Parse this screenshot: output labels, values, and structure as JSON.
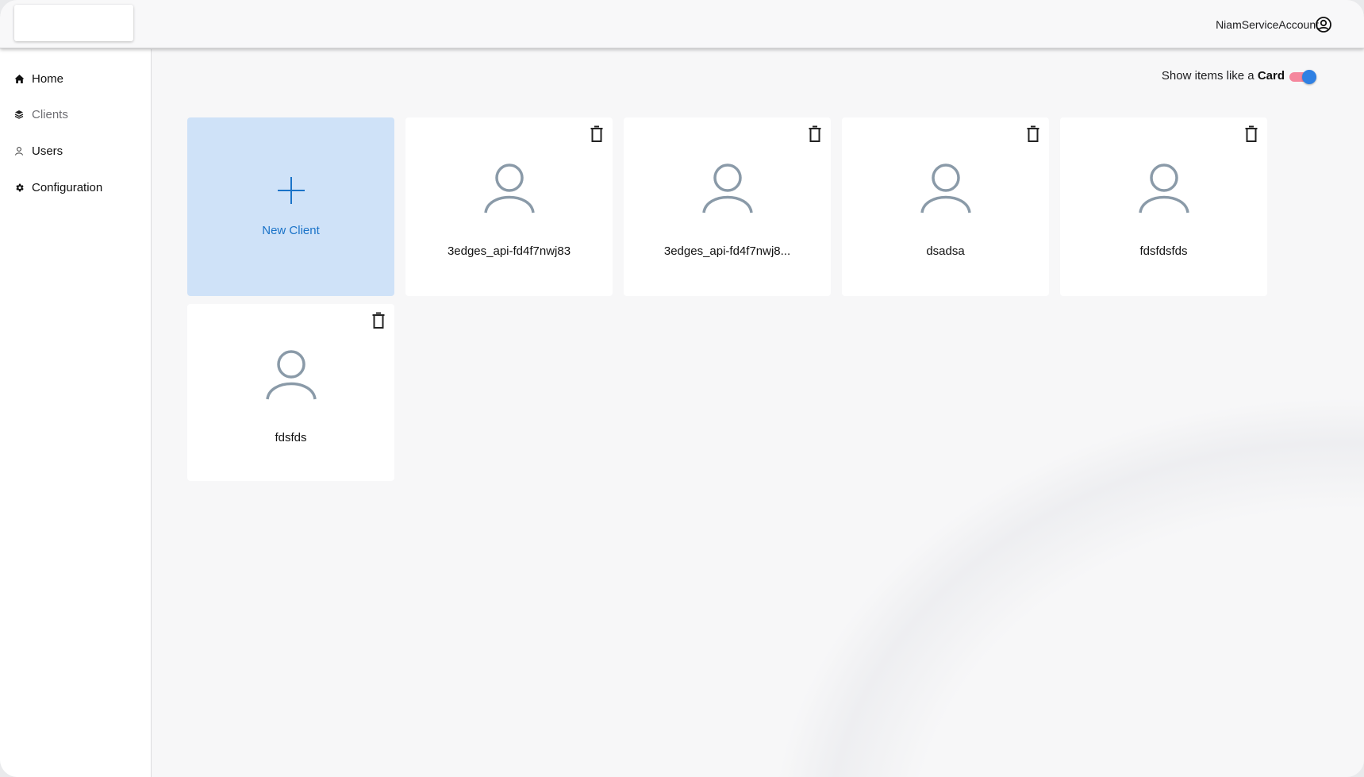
{
  "header": {
    "account_name": "NiamServiceAccount"
  },
  "sidebar": {
    "items": [
      {
        "label": "Home",
        "icon": "home-icon"
      },
      {
        "label": "Clients",
        "icon": "layers-icon"
      },
      {
        "label": "Users",
        "icon": "user-icon"
      },
      {
        "label": "Configuration",
        "icon": "gear-icon"
      }
    ],
    "active": "Clients"
  },
  "view_toggle": {
    "label_prefix": "Show items like a",
    "label_emphasis": "Card",
    "on": true
  },
  "new_client": {
    "label": "New Client"
  },
  "clients": [
    {
      "name": "3edges_api-fd4f7nwj83"
    },
    {
      "name": "3edges_api-fd4f7nwj8..."
    },
    {
      "name": "dsadsa"
    },
    {
      "name": "fdsfdsfds"
    },
    {
      "name": "fdsfds"
    }
  ],
  "colors": {
    "accent": "#1a73c8",
    "new_card_bg": "#cfe2f8",
    "toggle_track": "#f5879d",
    "toggle_thumb": "#2f80e3",
    "avatar": "#8a9aa8"
  }
}
